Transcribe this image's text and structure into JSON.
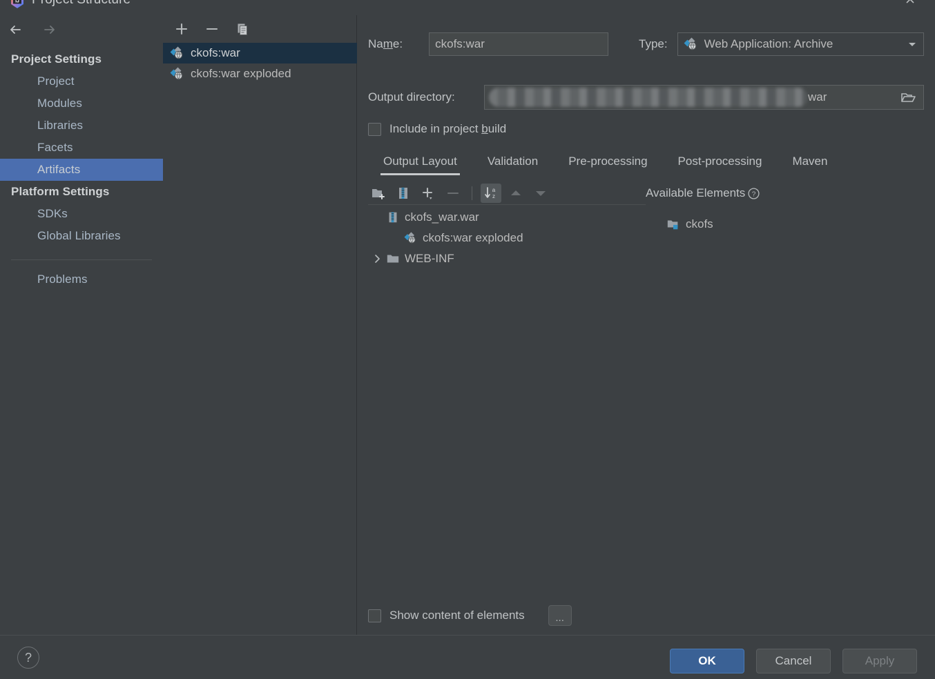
{
  "window": {
    "title": "Project Structure",
    "app_icon": "intellij-idea-icon",
    "close_label": "✕"
  },
  "nav": {
    "back_label": "←",
    "forward_label": "→"
  },
  "sidebar": {
    "groups": [
      {
        "label": "Project Settings",
        "items": [
          {
            "label": "Project",
            "selected": false
          },
          {
            "label": "Modules",
            "selected": false
          },
          {
            "label": "Libraries",
            "selected": false
          },
          {
            "label": "Facets",
            "selected": false
          },
          {
            "label": "Artifacts",
            "selected": true
          }
        ]
      },
      {
        "label": "Platform Settings",
        "items": [
          {
            "label": "SDKs",
            "selected": false
          },
          {
            "label": "Global Libraries",
            "selected": false
          }
        ]
      }
    ],
    "problems": {
      "label": "Problems"
    }
  },
  "artifact_list": {
    "toolbar": [
      {
        "name": "add-artifact-button",
        "glyph": "+"
      },
      {
        "name": "remove-artifact-button",
        "glyph": "−"
      },
      {
        "name": "copy-artifact-button",
        "glyph": "copy-icon"
      }
    ],
    "items": [
      {
        "label": "ckofs:war",
        "icon": "web-archive-icon",
        "selected": true
      },
      {
        "label": "ckofs:war exploded",
        "icon": "web-exploded-icon",
        "selected": false
      }
    ]
  },
  "detail": {
    "name_label": "Name:",
    "name_label_parts": {
      "pre": "Na",
      "mnemonic": "m",
      "post": "e:"
    },
    "name_value": "ckofs:war",
    "type_label": "Type:",
    "type_value": "Web Application: Archive",
    "type_icon": "web-archive-icon",
    "type_arrow": "▼",
    "output_dir_label": "Output directory:",
    "output_dir_value_visible": "war",
    "output_dir_redacted": true,
    "browse_icon": "folder-open-icon",
    "include_in_build": {
      "label": "Include in project build",
      "label_parts": {
        "pre": "Include in project ",
        "mnemonic": "b",
        "post": "uild"
      },
      "checked": false
    },
    "tabs": [
      {
        "label": "Output Layout",
        "active": true
      },
      {
        "label": "Validation",
        "active": false
      },
      {
        "label": "Pre-processing",
        "active": false
      },
      {
        "label": "Post-processing",
        "active": false
      },
      {
        "label": "Maven",
        "active": false
      }
    ],
    "layout_toolbar": [
      {
        "name": "create-directory-button",
        "icon": "new-folder-icon",
        "state": "enabled"
      },
      {
        "name": "create-archive-button",
        "icon": "archive-icon",
        "state": "enabled"
      },
      {
        "name": "add-copy-of-button",
        "icon": "plus-dropdown-icon",
        "state": "enabled"
      },
      {
        "name": "remove-element-button",
        "icon": "minus-icon",
        "state": "disabled"
      },
      {
        "name": "sort-alphabetically-button",
        "icon": "sort-az-icon",
        "state": "toggled"
      },
      {
        "name": "move-up-button",
        "icon": "arrow-up-icon",
        "state": "disabled"
      },
      {
        "name": "move-down-button",
        "icon": "arrow-down-icon",
        "state": "disabled"
      }
    ],
    "output_tree": [
      {
        "label": "ckofs_war.war",
        "icon": "archive-icon",
        "indent": 0,
        "expander": "none"
      },
      {
        "label": "ckofs:war exploded",
        "icon": "web-exploded-icon",
        "indent": 1,
        "expander": "none"
      },
      {
        "label": "WEB-INF",
        "icon": "folder-icon",
        "indent": 0,
        "expander": "collapsed"
      }
    ],
    "available_elements": {
      "title": "Available Elements",
      "help_icon": "question-circle-icon",
      "items": [
        {
          "label": "ckofs",
          "icon": "module-output-icon",
          "indent": 1
        }
      ]
    },
    "show_content": {
      "label": "Show content of elements",
      "checked": false,
      "more_button_label": "..."
    }
  },
  "footer": {
    "help_label": "?",
    "ok_label": "OK",
    "cancel_label": "Cancel",
    "apply_label": "Apply",
    "apply_disabled": true
  },
  "colors": {
    "window_bg": "#3c4043",
    "sidebar_selection": "#4b6eaf",
    "list_selection": "#1b3042",
    "accent_blue": "#3a6195",
    "icon_cyan": "#3592c4",
    "text": "#bbbbbb",
    "text_bright": "#cfd2d4",
    "text_disabled": "#7d8184",
    "border": "#5e6264"
  }
}
